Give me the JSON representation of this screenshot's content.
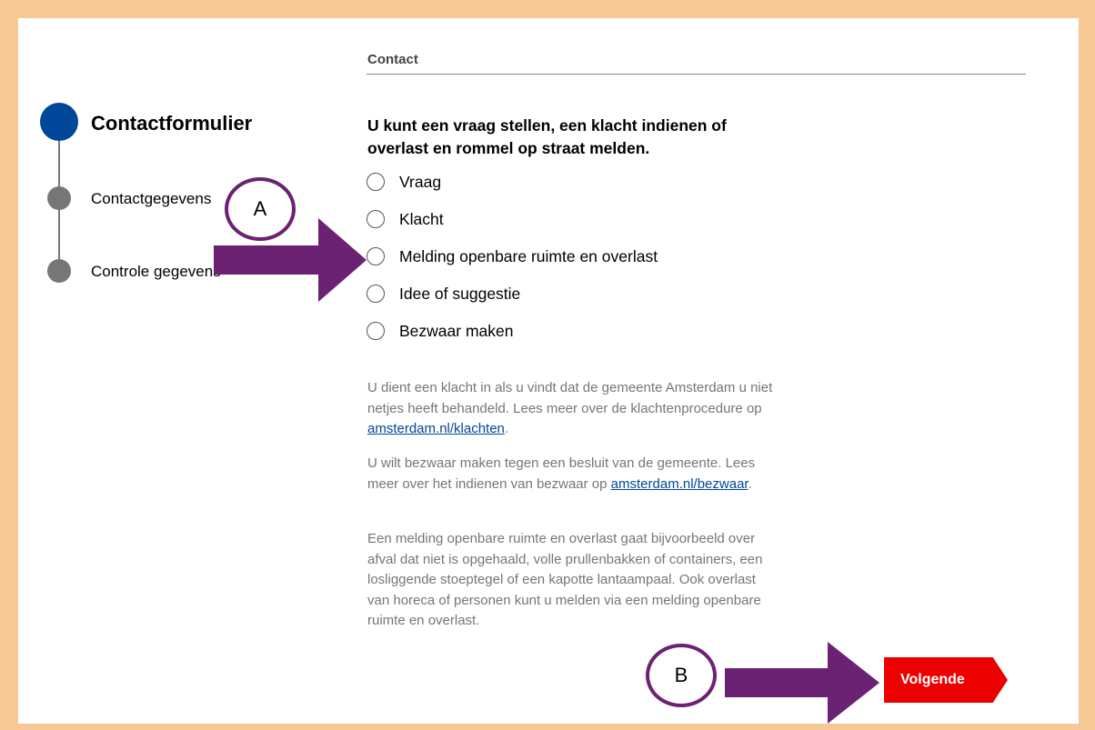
{
  "section": {
    "title": "Contact"
  },
  "stepper": {
    "steps": [
      {
        "label": "Contactformulier",
        "state": "active"
      },
      {
        "label": "Contactgegevens",
        "state": "upcoming"
      },
      {
        "label": "Controle gegevens",
        "state": "upcoming"
      }
    ]
  },
  "form": {
    "question": "U kunt een vraag stellen, een klacht indienen of overlast en rommel op straat melden.",
    "options": [
      {
        "label": "Vraag",
        "checked": false
      },
      {
        "label": "Klacht",
        "checked": false
      },
      {
        "label": "Melding openbare ruimte en overlast",
        "checked": false
      },
      {
        "label": "Idee of suggestie",
        "checked": false
      },
      {
        "label": "Bezwaar maken",
        "checked": false
      }
    ]
  },
  "info": {
    "klacht_text": "U dient een klacht in als u vindt dat de gemeente Amsterdam u niet netjes heeft behandeld. Lees meer over de klachtenprocedure op ",
    "klacht_link": "amsterdam.nl/klachten",
    "klacht_end": ".",
    "bezwaar_text": "U wilt bezwaar maken tegen een besluit van de gemeente. Lees meer over het indienen van bezwaar op ",
    "bezwaar_link": "amsterdam.nl/bezwaar",
    "bezwaar_end": ".",
    "melding_text": "Een melding openbare ruimte en overlast gaat bijvoorbeeld over afval dat niet is opgehaald, volle prullenbakken of containers, een losliggende stoeptegel of een kapotte lantaampaal. Ook overlast van horeca of personen kunt u melden via een melding openbare ruimte en overlast."
  },
  "actions": {
    "next_label": "Volgende"
  },
  "annotations": {
    "marker_a": "A",
    "marker_b": "B"
  },
  "colors": {
    "frame": "#f5c896",
    "primary_blue": "#004699",
    "step_gray": "#767676",
    "button_red": "#ec0000",
    "annotation_purple": "#6b2272"
  }
}
